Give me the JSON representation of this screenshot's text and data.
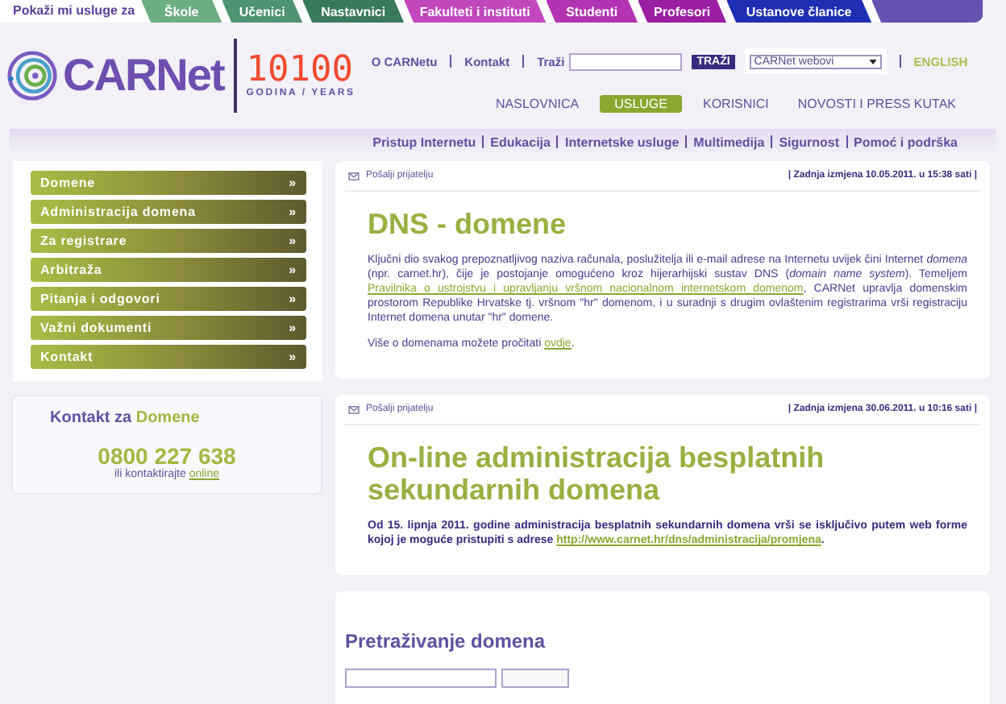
{
  "audience_bar": {
    "label": "Pokaži mi usluge za",
    "tabs": [
      {
        "label": "Škole",
        "color": "#6cae82"
      },
      {
        "label": "Učenici",
        "color": "#4f9470"
      },
      {
        "label": "Nastavnici",
        "color": "#3a7a5c"
      },
      {
        "label": "Fakulteti i instituti",
        "color": "#c247bd"
      },
      {
        "label": "Studenti",
        "color": "#b334b3"
      },
      {
        "label": "Profesori",
        "color": "#9c1ea3"
      },
      {
        "label": "Ustanove članice",
        "color": "#1f2fb3"
      },
      {
        "color": "#6652b3"
      }
    ]
  },
  "logo": {
    "name": "CARNet",
    "anniversary": "10100",
    "anniversary_sub": "GODINA / YEARS"
  },
  "top_links": [
    {
      "label": "O CARNetu"
    },
    {
      "label": "Kontakt"
    }
  ],
  "search": {
    "label": "Traži",
    "button": "TRAŽI"
  },
  "site_select": {
    "value": "CARNet webovi"
  },
  "language_link": "ENGLISH",
  "main_nav": [
    {
      "label": "NASLOVNICA",
      "selected": false
    },
    {
      "label": "USLUGE",
      "selected": true
    },
    {
      "label": "KORISNICI",
      "selected": false
    },
    {
      "label": "NOVOSTI I PRESS KUTAK",
      "selected": false
    }
  ],
  "sub_nav": [
    "Pristup Internetu",
    "Edukacija",
    "Internetske usluge",
    "Multimedija",
    "Sigurnost",
    "Pomoć i podrška"
  ],
  "sidebar": {
    "items": [
      {
        "label": "Domene",
        "arrow": "»"
      },
      {
        "label": "Administracija domena",
        "arrow": "»"
      },
      {
        "label": "Za registrare",
        "arrow": "»"
      },
      {
        "label": "Arbitraža",
        "arrow": "»"
      },
      {
        "label": "Pitanja i odgovori",
        "arrow": "»"
      },
      {
        "label": "Važni dokumenti",
        "arrow": "»"
      },
      {
        "label": "Kontakt",
        "arrow": "»"
      }
    ],
    "contact": {
      "title": "Kontakt za",
      "title_highlight": "Domene",
      "phone": "0800 227 638",
      "note": "ili kontaktirajte",
      "link": "online"
    }
  },
  "articles": [
    {
      "send_link": "Pošalji prijatelju",
      "modified": "| Zadnja izmjena 10.05.2011. u 15:38 sati |",
      "title": "DNS - domene",
      "bold_text": false,
      "paragraphs": [
        [
          {
            "kind": "text",
            "text": "Ključni dio svakog prepoznatljivog naziva računala, poslužitelja ili e-mail adrese na Internetu uvijek čini Internet *domena* (npr. carnet.hr), čije je postojanje omogućeno kroz hijerarhijski sustav DNS (*domain name system*). Temeljem "
          },
          {
            "kind": "link",
            "text": "Pravilnika o ustrojstvu i upravljanju vršnom nacionalnom internetskom domenom"
          },
          {
            "kind": "text",
            "text": ", CARNet upravlja domenskim prostorom Republike Hrvatske tj. vršnom \"hr\" domenom, i u suradnji s drugim ovlaštenim registrarima vrši registraciju Internet domena unutar \"hr\" domene."
          }
        ],
        [
          {
            "kind": "text",
            "text": "Više o domenama možete pročitati "
          },
          {
            "kind": "link",
            "text": "ovdje"
          },
          {
            "kind": "text",
            "text": "."
          }
        ]
      ]
    },
    {
      "send_link": "Pošalji prijatelju",
      "modified": "| Zadnja izmjena 30.06.2011. u 10:16 sati |",
      "title": "On-line administracija besplatnih sekundarnih domena",
      "bold_text": true,
      "paragraphs": [
        [
          {
            "kind": "text",
            "text": "Od 15. lipnja 2011. godine administracija besplatnih sekundarnih domena vrši se isključivo putem web forme kojoj je moguće pristupiti s adrese "
          },
          {
            "kind": "link",
            "text": "http://www.carnet.hr/dns/administracija/promjena"
          },
          {
            "kind": "text",
            "text": "."
          }
        ]
      ]
    }
  ],
  "domain_search": {
    "title": "Pretraživanje domena"
  }
}
